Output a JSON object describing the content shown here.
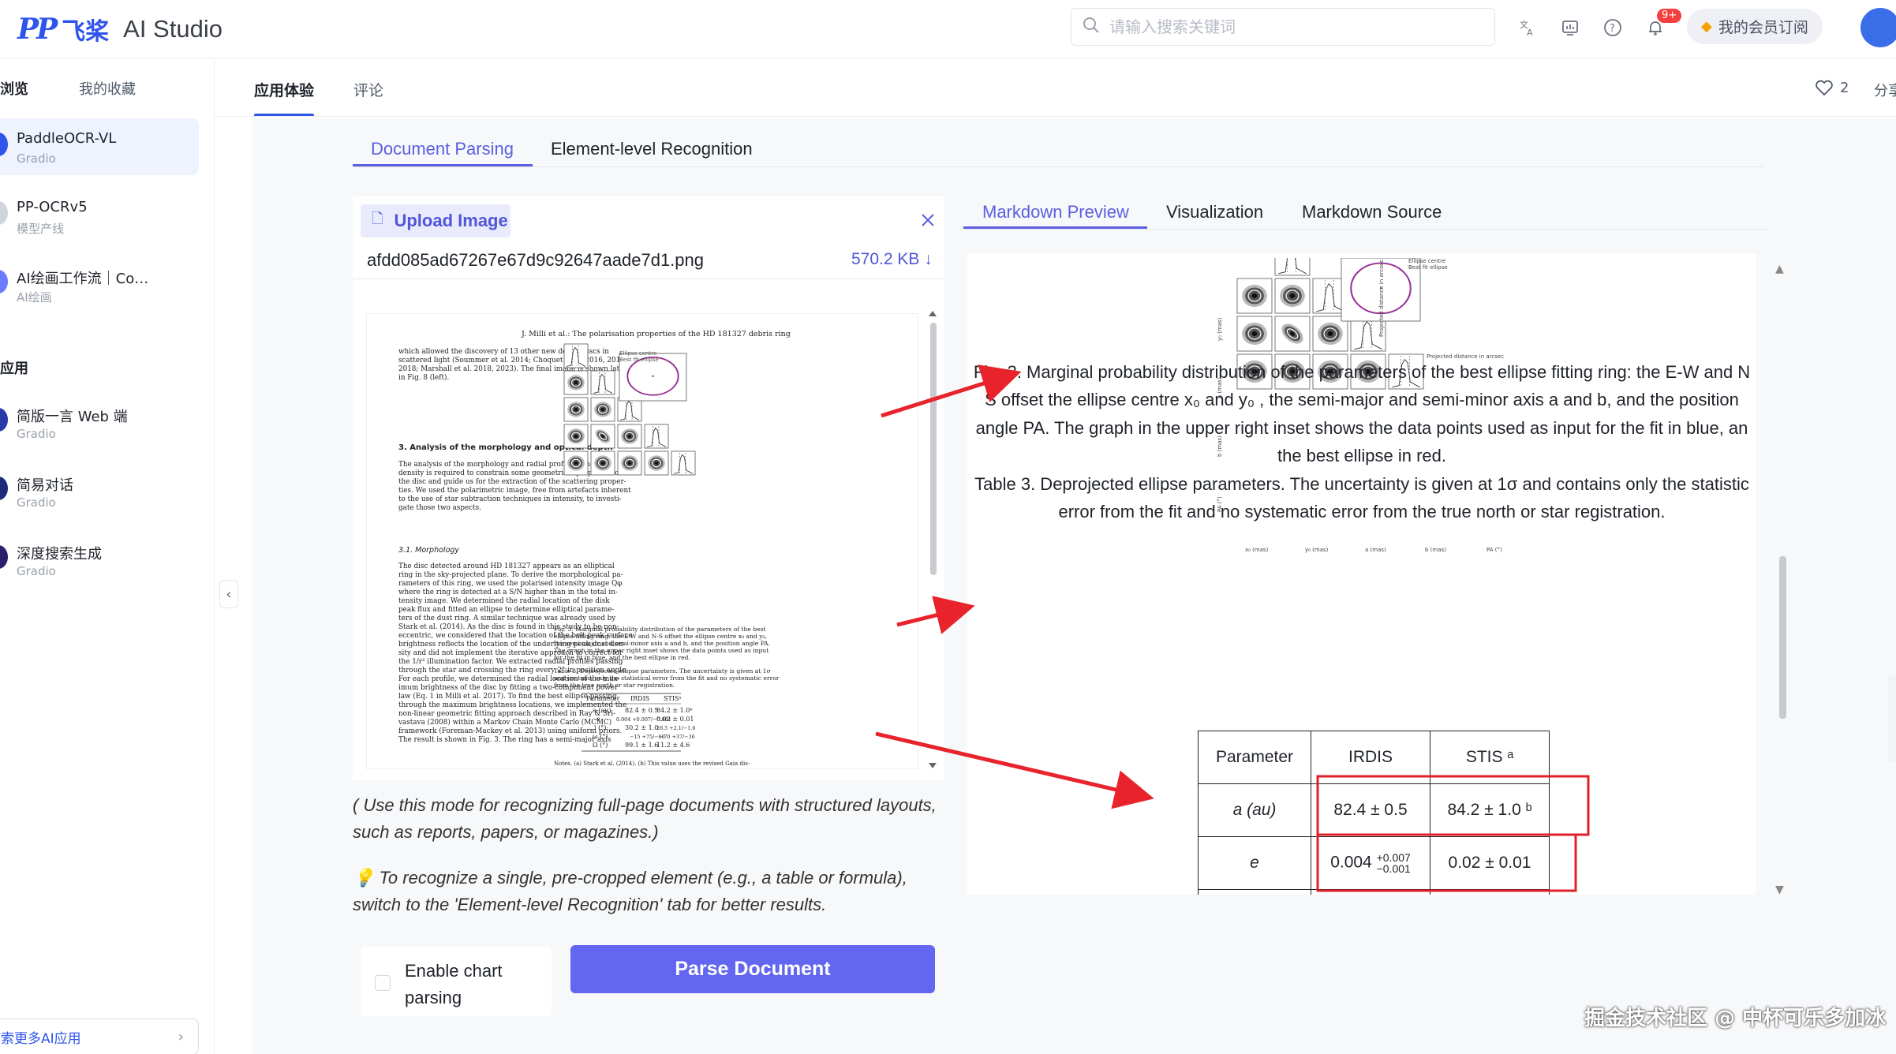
{
  "app": {
    "logo_mark": "PP",
    "logo_cn": "飞桨",
    "logo_en": "AI Studio",
    "search_placeholder": "请输入搜索关键词",
    "notification_badge": "9+",
    "member_label": "我的会员订阅"
  },
  "sidebar": {
    "tabs": [
      "浏览",
      "我的收藏"
    ],
    "items": [
      {
        "title": "PaddleOCR-VL",
        "subtitle": "Gradio",
        "selected": true,
        "color": "#2f54eb"
      },
      {
        "title": "PP-OCRv5",
        "subtitle": "模型产线",
        "selected": false,
        "color": "#d0d4dc"
      },
      {
        "title": "AI绘画工作流｜Co…",
        "subtitle": "AI绘画",
        "selected": false,
        "color": "#6b7cff"
      }
    ],
    "section_title": "应用",
    "apps": [
      {
        "title": "简版一言 Web 端",
        "subtitle": "Gradio",
        "color": "#2a3aa8"
      },
      {
        "title": "简易对话",
        "subtitle": "Gradio",
        "color": "#1f2b7a"
      },
      {
        "title": "深度搜索生成",
        "subtitle": "Gradio",
        "color": "#2a1f6b"
      }
    ],
    "more_label": "索更多AI应用",
    "collapse_glyph": "‹"
  },
  "header": {
    "tabs": [
      "应用体验",
      "评论"
    ],
    "like_count": "2",
    "share_label": "分享"
  },
  "parser": {
    "mode_tabs": [
      "Document Parsing",
      "Element-level Recognition"
    ],
    "upload_label": "Upload Image",
    "file_name": "afdd085ad67267e67d9c92647aade7d1.png",
    "file_size": "570.2 KB ↓",
    "hint1_line1": "( Use this mode for recognizing full-page documents with structured layouts,",
    "hint1_line2": "such as reports, papers, or magazines.)",
    "hint2_line1": "💡  To recognize a single, pre-cropped element (e.g., a table or formula),",
    "hint2_line2": "switch to the 'Element-level Recognition' tab for better results.",
    "chart_parsing_line1": "Enable chart",
    "chart_parsing_line2": "parsing",
    "parse_button": "Parse Document"
  },
  "document": {
    "header": "J. Milli  et al.: The polarisation properties of the HD 181327 debris ring",
    "section_title": "3. Analysis of the morphology and optical depth",
    "subsection_title": "3.1. Morphology",
    "para1": [
      "which allowed the discovery of 13 other new debris discs in",
      "scattered light (Soummer et al. 2014; Choquet et al. 2016, 2017,",
      "2018; Marshall et al. 2018, 2023). The final image is shown later",
      "in Fig. 8 (left)."
    ],
    "para2": [
      "The analysis of the morphology and radial profile of the dust",
      "density is required to constrain some geometrical properties of",
      "the disc and guide us for the extraction of the scattering proper-",
      "ties. We used the polarimetric image, free from artefacts inherent",
      "to the use of star subtraction techniques in intensity, to investi-",
      "gate those two aspects."
    ],
    "para3": [
      "The disc detected around HD 181327 appears as an elliptical",
      "ring in the sky-projected plane. To derive the morphological pa-",
      "rameters of this ring, we used the polarised intensity image Qφ",
      "where the ring is detected at a S/N higher than in the total in-",
      "tensity image. We determined the radial location of the disk",
      "peak flux and fitted an ellipse to determine elliptical parame-",
      "ters of the dust ring. A similar technique was already used by",
      "Stark et al. (2014). As the disc is found in this study to be non-",
      "eccentric, we considered that the location of the belt peak surface",
      "brightness reflects the location of the underlying peak dust den-",
      "sity and did not implement the iterative approach to correct for",
      "the 1/r² illumination factor. We extracted radial profiles passing",
      "through the star and crossing the ring every 2° in position angle.",
      "For each profile, we determined the radial location of the max-",
      "imum brightness of the disc by fitting a two-component power",
      "law (Eq. 1 in Milli et al. 2017). To find the best ellipse passing",
      "through the maximum brightness locations, we implemented the",
      "non-linear geometric fitting approach described in Ray & Sri-",
      "vastava (2008) within a Markov Chain Monte Carlo (MCMC)",
      "framework (Foreman-Mackey et al. 2013) using uniform priors.",
      "The result is shown in Fig. 3. The ring has a semi-major axis"
    ],
    "fig_caption": [
      "Fig. 3. Marginal probability distribution of the parameters of the best",
      "ellipse fitting ring: the E-W and N-S offset the ellipse centre x₀ and y₀,",
      "the semi-major and semi-minor axis a and b, and the position angle PA.",
      "The graph in the upper right inset shows the data points used as input",
      "for the fit in blue, and the best ellipse in red."
    ],
    "table_caption": [
      "Table 3. Deprojected ellipse parameters. The uncertainty is given at 1σ",
      "and contains only the statistical error from the fit and no systematic error",
      "from the true north or star registration."
    ],
    "table_header": [
      "Parameter",
      "IRDIS",
      "STISᵃ"
    ],
    "table_rows": [
      [
        "a (au)",
        "82.4 ± 0.5",
        "84.2 ± 1.0ᵇ"
      ],
      [
        "e",
        "0.004 +0.007/−0.001",
        "0.02 ± 0.01"
      ],
      [
        "i (°)",
        "30.2 ± 1.0",
        "28.5 +2.1/−1.6"
      ],
      [
        "ω (°)",
        "−15 +75/−60",
        "−70 +37/−36"
      ],
      [
        "Ω (°)",
        "99.1 ± 1.6",
        "11.2 ± 4.6"
      ]
    ],
    "notes": "Notes. (a) Stark et al. (2014). (b) This value uses the revised Gaia dis-",
    "inset_legend": [
      "Ellipse centre",
      "Best fit ellipse"
    ]
  },
  "result": {
    "tabs": [
      "Markdown Preview",
      "Visualization",
      "Markdown Source"
    ],
    "caption_lines": [
      "Fig. 3. Marginal probability distribution of the parameters of the best ellipse fitting ring: the E-W and N",
      "S offset the ellipse centre x₀ and y₀ , the semi-major and semi-minor axis a and b, and the position",
      "angle PA. The graph in the upper right inset shows the data points used as input for the fit in blue, an",
      "the best ellipse in red.",
      "Table 3. Deprojected ellipse parameters. The uncertainty is given at 1σ and contains only the statistic",
      "error from the fit and no systematic error from the true north or star registration."
    ],
    "table": {
      "header": [
        "Parameter",
        "IRDIS",
        "STIS ᵃ"
      ],
      "row_a": [
        "a (au)",
        "82.4 ± 0.5",
        "84.2 ± 1.0 ᵇ"
      ],
      "row_e": [
        "e",
        "0.004",
        "+0.007",
        "−0.001",
        "0.02 ± 0.01"
      ]
    },
    "inset_legend": [
      "Ellipse centre",
      "Best fit ellipse"
    ],
    "inset_x_label": "Projected distance in arcsec",
    "inset_y_label": "Projected distance in arcsec",
    "bottom_labels": [
      "x₀ (mas)",
      "y₀ (mas)",
      "a (mas)",
      "b (mas)",
      "PA (°)"
    ],
    "side_labels": [
      "y₀ (mas)",
      "a (mas)",
      "b (mas)",
      "PA (°)"
    ]
  },
  "watermark": "掘金技术社区 @ 中杯可乐多加冰",
  "colors": {
    "accent": "#5b5fe0",
    "brand_blue": "#2f54eb",
    "arrow_red": "#e8232b",
    "highlight_box": "#e0202a"
  }
}
